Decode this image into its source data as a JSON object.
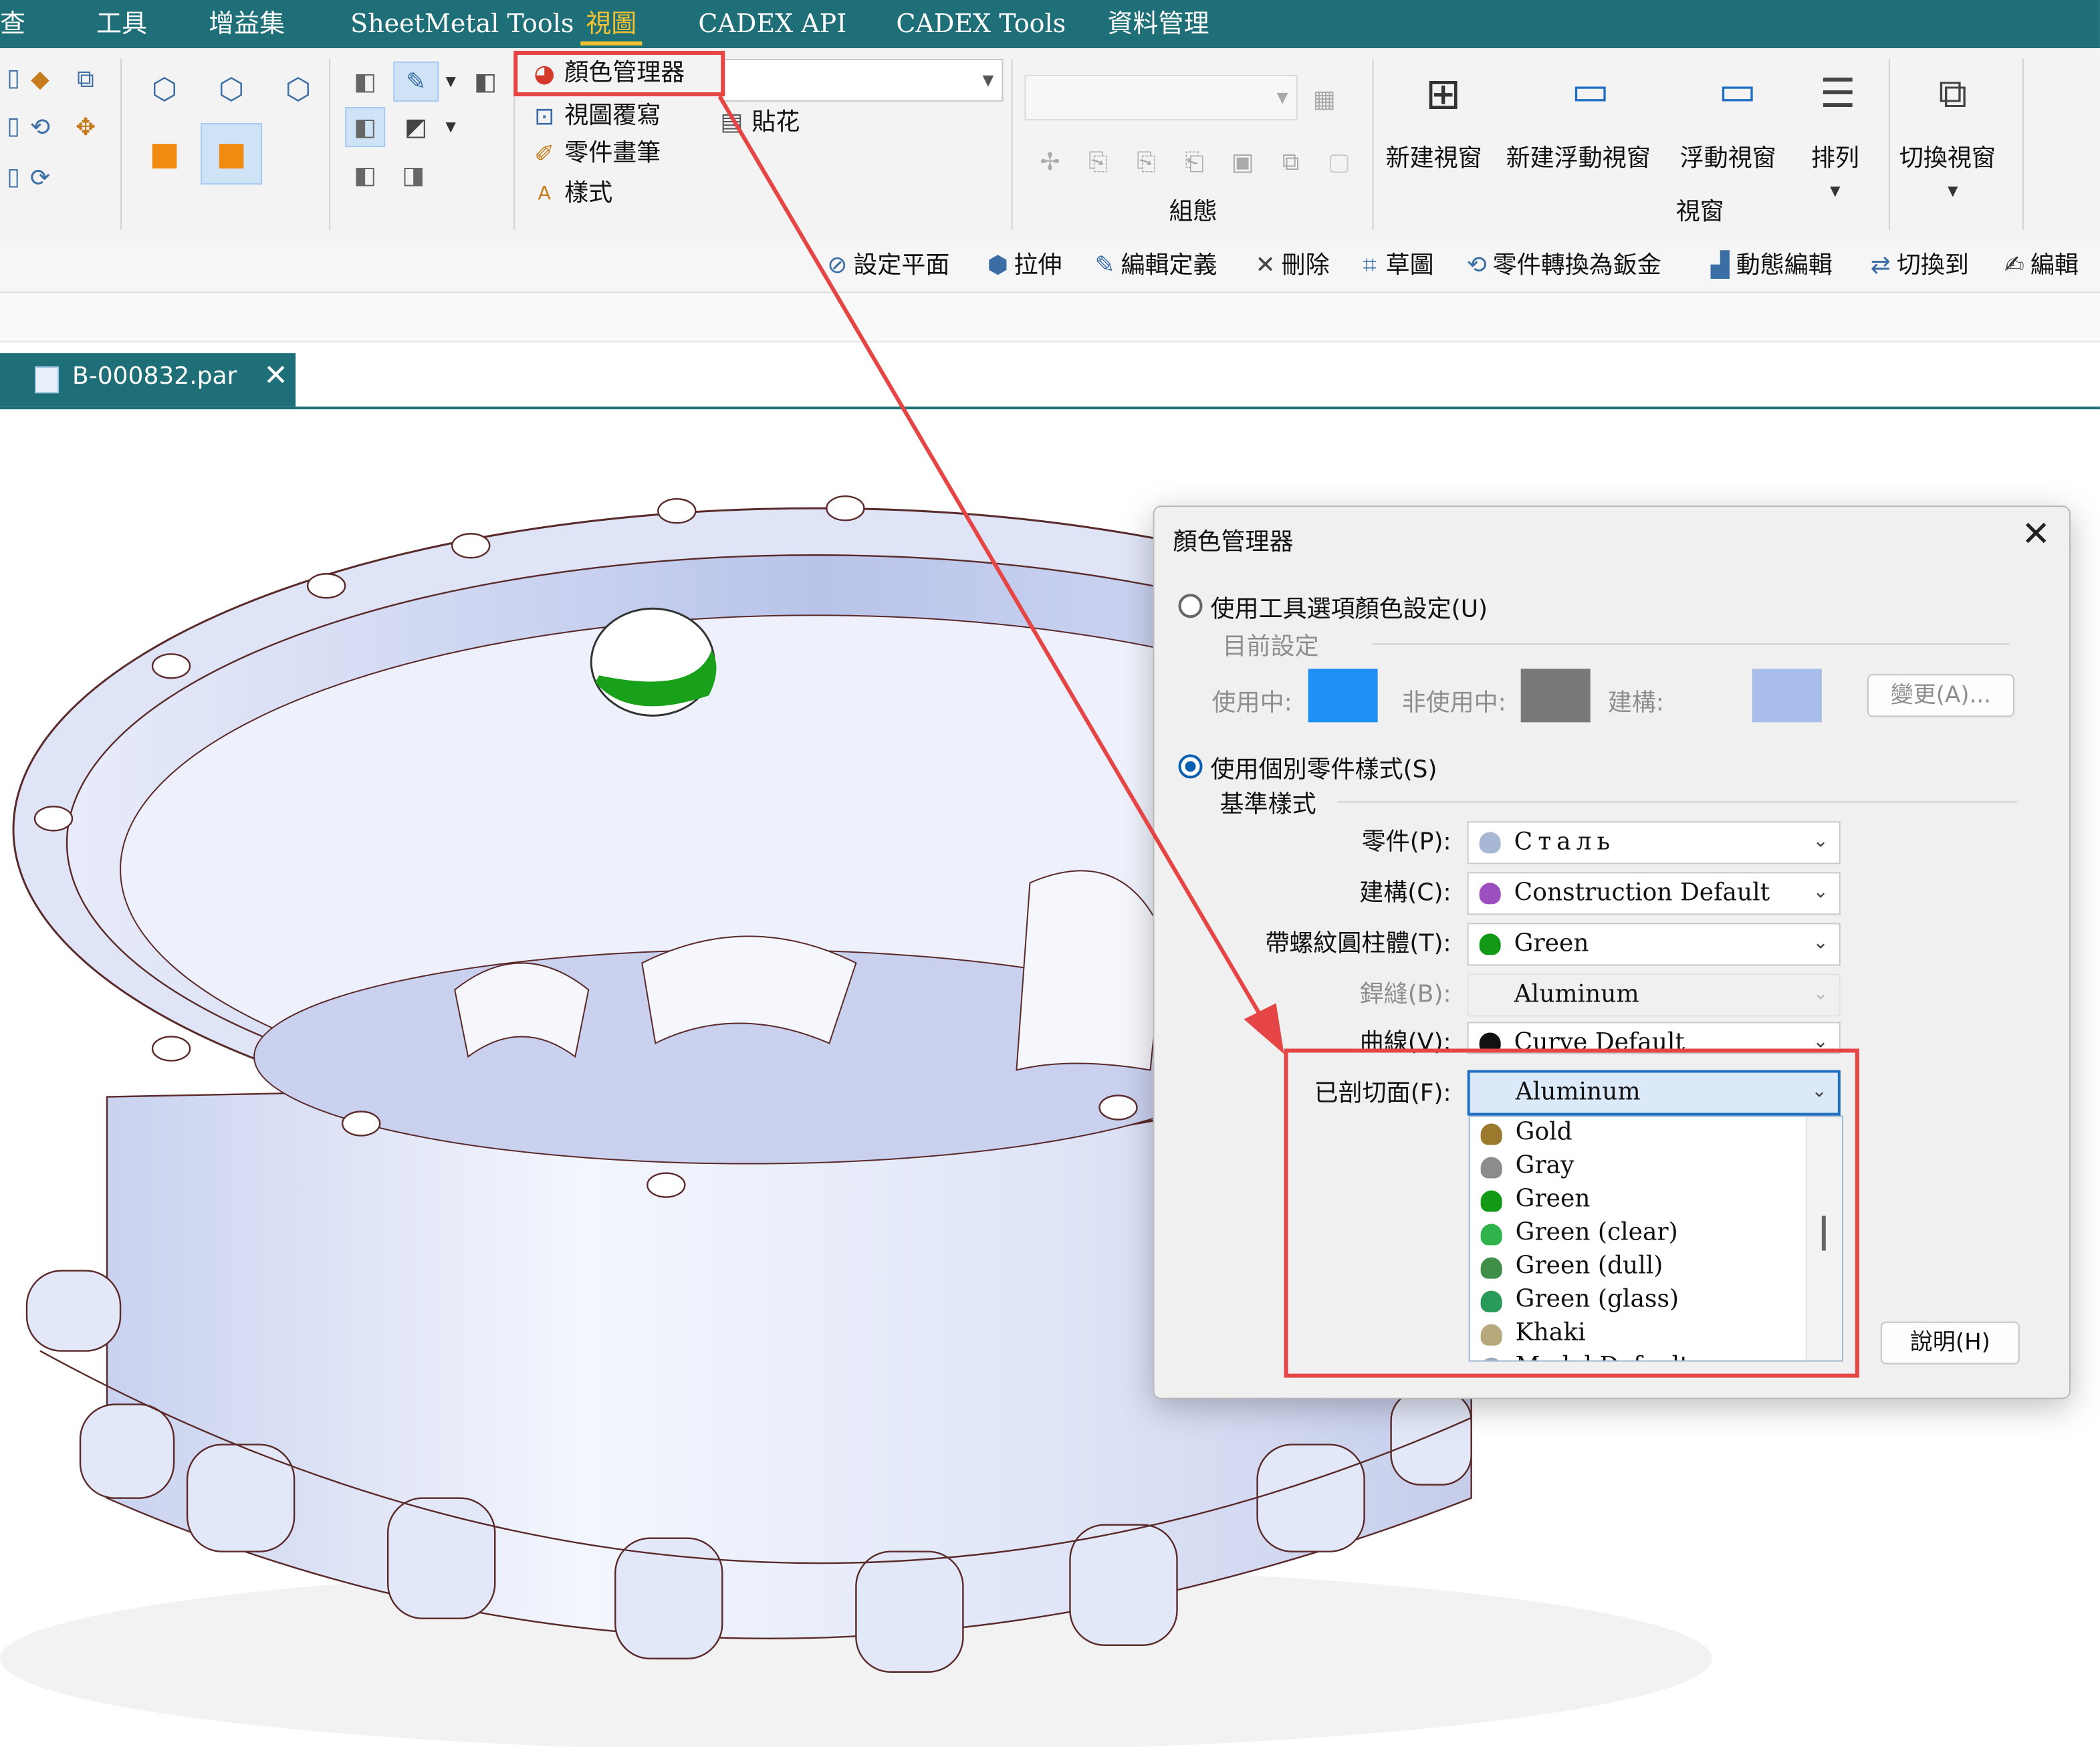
{
  "menu": {
    "items": [
      "查",
      "工具",
      "增益集",
      "SheetMetal Tools",
      "視圖",
      "CADEX API",
      "CADEX Tools",
      "資料管理"
    ],
    "active_index": 4
  },
  "ribbon": {
    "color_manager_label": "顏色管理器",
    "view_overlay_label": "視圖覆寫",
    "part_painter_label": "零件畫筆",
    "styles_label": "樣式",
    "decal_label": "貼花",
    "config_group_label": "組態",
    "new_window_label": "新建視窗",
    "new_floating_window_label": "新建浮動視窗",
    "floating_window_label": "浮動視窗",
    "arrange_label": "排列",
    "switch_window_label": "切換視窗",
    "window_group_label": "視窗"
  },
  "commands": [
    "設定平面",
    "拉伸",
    "編輯定義",
    "刪除",
    "草圖",
    "零件轉換為鈑金",
    "動態編輯",
    "切換到",
    "編輯"
  ],
  "document_tab": {
    "title": "B-000832.par",
    "close": "✕"
  },
  "dialog": {
    "title": "顏色管理器",
    "close": "✕",
    "use_tool_options_label": "使用工具選項顏色設定(U)",
    "current_settings_label": "目前設定",
    "active_label": "使用中:",
    "inactive_label": "非使用中:",
    "construction_label": "建構:",
    "active_color": "#1e90f5",
    "inactive_color": "#787878",
    "construction_color": "#a9bdea",
    "change_button": "變更(A)...",
    "use_part_styles_label": "使用個別零件樣式(S)",
    "base_styles_label": "基準樣式",
    "fields": [
      {
        "label": "零件(P):",
        "value": "Сталь",
        "color": "#a8b8d4",
        "disabled": false
      },
      {
        "label": "建構(C):",
        "value": "Construction Default",
        "color": "#9d4fc0",
        "disabled": false
      },
      {
        "label": "帶螺紋圓柱體(T):",
        "value": "Green",
        "color": "#129a16",
        "disabled": false
      },
      {
        "label": "銲縫(B):",
        "value": "Aluminum",
        "color": "",
        "disabled": true
      },
      {
        "label": "曲線(V):",
        "value": "Curve Default",
        "color": "#111111",
        "disabled": false
      },
      {
        "label": "已剖切面(F):",
        "value": "Aluminum",
        "color": "",
        "disabled": false
      }
    ],
    "dropdown_options": [
      {
        "name": "Gold",
        "color": "#9b7a2e"
      },
      {
        "name": "Gray",
        "color": "#8c8c8c"
      },
      {
        "name": "Green",
        "color": "#129a16"
      },
      {
        "name": "Green (clear)",
        "color": "#2fb34a"
      },
      {
        "name": "Green (dull)",
        "color": "#3f8f49"
      },
      {
        "name": "Green (glass)",
        "color": "#2a9a58"
      },
      {
        "name": "Khaki",
        "color": "#b8a97c"
      },
      {
        "name": "Model Default",
        "color": "#9aa8bf"
      }
    ],
    "help_button": "說明(H)"
  }
}
